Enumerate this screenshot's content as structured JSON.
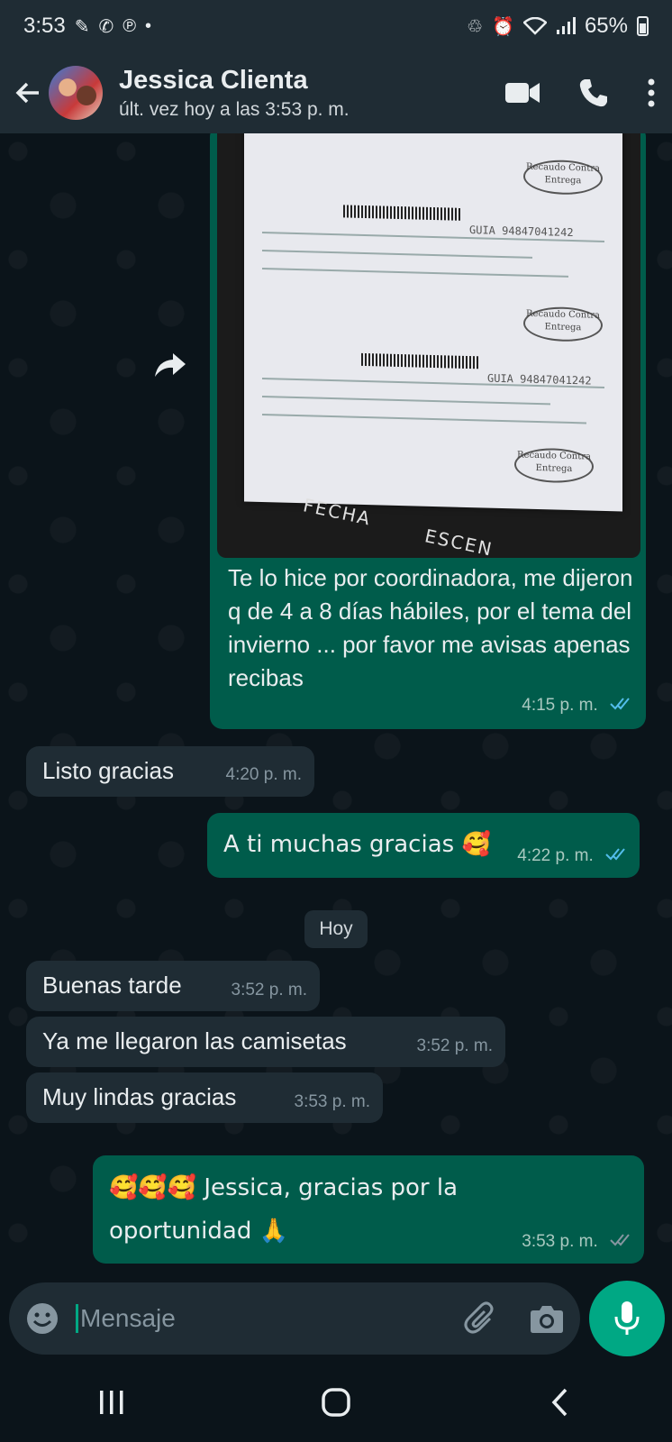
{
  "status_bar": {
    "time": "3:53",
    "battery": "65%"
  },
  "header": {
    "contact_name": "Jessica Clienta",
    "last_seen": "últ. vez hoy a las 3:53 p. m."
  },
  "image_message": {
    "receipt_texts": {
      "guia_top": "GUIA 94847041242",
      "guia_bottom": "GUIA 94847041242",
      "stamp": "Recaudo Contra Entrega",
      "fecha": "FECHA",
      "escen": "ESCEN"
    },
    "caption": "Te lo hice  por coordinadora, me dijeron q de 4 a 8 días hábiles, por el tema del invierno ... por favor me avisas apenas recibas",
    "time": "4:15 p. m."
  },
  "messages": [
    {
      "direction": "in",
      "text": "Listo gracias",
      "time": "4:20 p. m."
    },
    {
      "direction": "out",
      "text": "A ti muchas gracias 🥰",
      "time": "4:22 p. m."
    },
    {
      "direction": "in",
      "text": "Buenas tarde",
      "time": "3:52 p. m."
    },
    {
      "direction": "in",
      "text": "Ya me llegaron las camisetas",
      "time": "3:52 p. m."
    },
    {
      "direction": "in",
      "text": "Muy lindas gracias",
      "time": "3:53 p. m."
    },
    {
      "direction": "out",
      "text": "🥰🥰🥰 Jessica, gracias por la oportunidad 🙏",
      "time": "3:53 p. m."
    }
  ],
  "day_divider": "Hoy",
  "composer": {
    "placeholder": "Mensaje"
  },
  "colors": {
    "outgoing_bubble": "#005c4b",
    "incoming_bubble": "#1f2c34",
    "accent": "#00a884",
    "read_ticks": "#53bdeb"
  }
}
